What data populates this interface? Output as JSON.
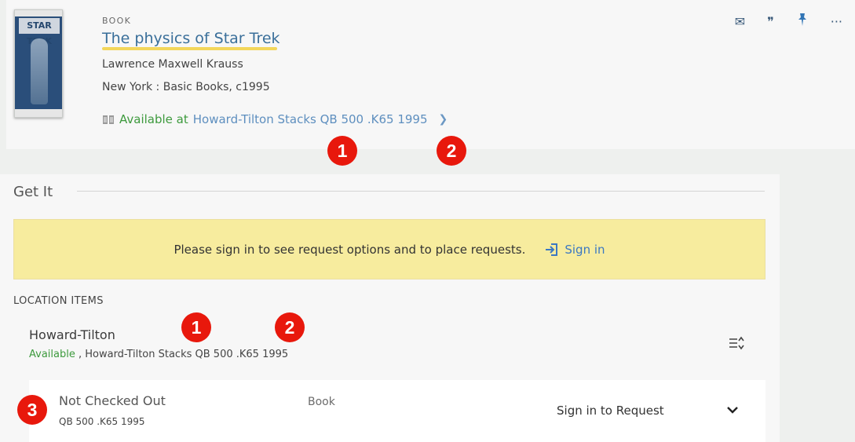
{
  "record": {
    "cover_logo": "STAR TREK",
    "type": "BOOK",
    "title": "The physics of Star Trek",
    "author": "Lawrence Maxwell Krauss",
    "publication": "New York : Basic Books, c1995",
    "availability_status": "Available at",
    "availability_location": "Howard-Tilton Stacks QB 500 .K65 1995",
    "actions": {
      "email_icon": "✉",
      "cite_icon": "❞",
      "pin_icon": "📌",
      "more_icon": "···"
    }
  },
  "badges": [
    "1",
    "2",
    "1",
    "2",
    "3"
  ],
  "get_it": {
    "title": "Get It",
    "notice_text": "Please sign in to see request options and to place requests.",
    "sign_in_label": "Sign in",
    "location_items_label": "LOCATION ITEMS",
    "library_name": "Howard-Tilton",
    "library_status": "Available",
    "library_location": " , Howard-Tilton Stacks QB 500 .K65 1995",
    "item": {
      "status": "Not Checked Out",
      "call_number": "QB 500 .K65 1995",
      "type": "Book",
      "request_label": "Sign in to Request"
    }
  },
  "colors": {
    "available": "#3d9a3d",
    "link": "#5e8fbf",
    "badge": "#e8180c",
    "notice_bg": "#f7ec9e"
  }
}
